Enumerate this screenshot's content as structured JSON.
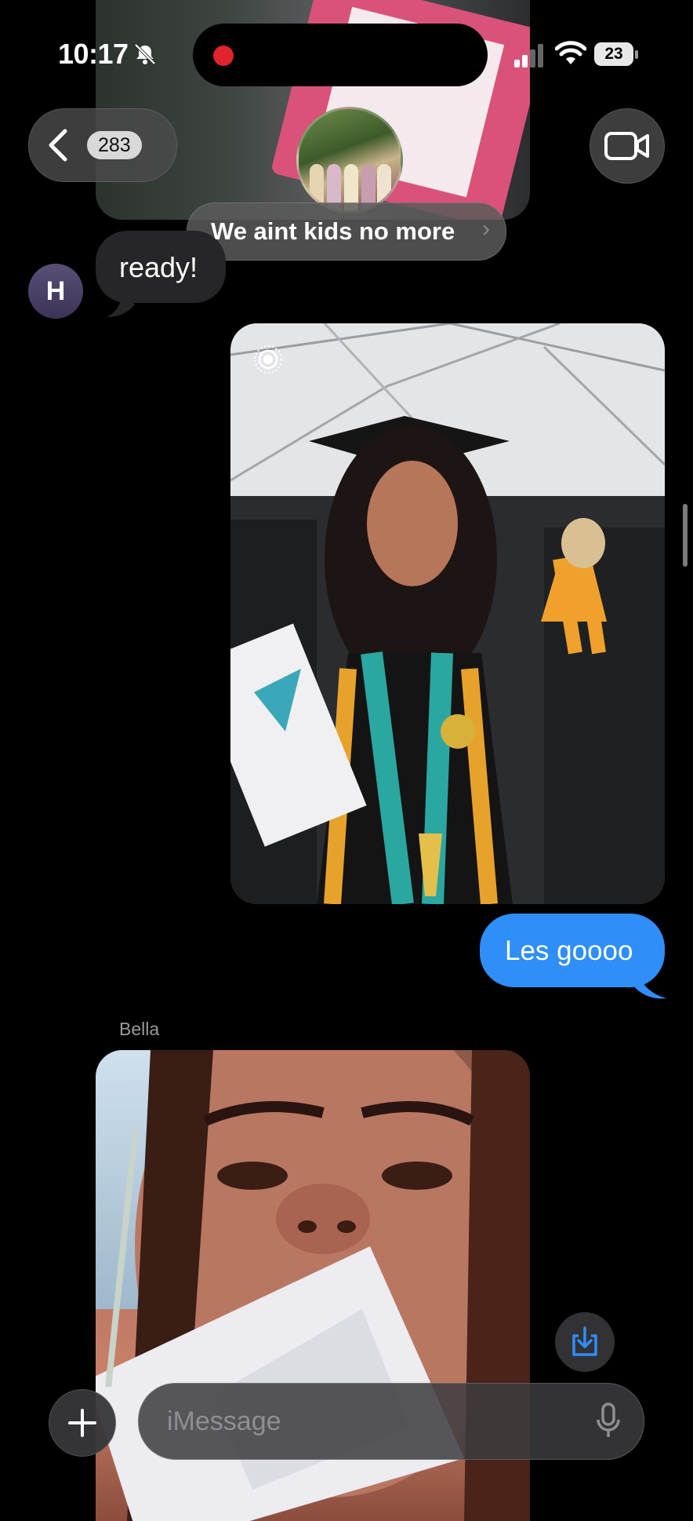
{
  "status_bar": {
    "time": "10:17",
    "battery": "23"
  },
  "header": {
    "back_count": "283",
    "group_name": "We aint kids no more",
    "chevron": "›"
  },
  "messages": [
    {
      "id": "ready",
      "type": "text",
      "direction": "incoming",
      "avatar_letter": "H",
      "text": "ready!"
    },
    {
      "id": "grad-photo",
      "type": "photo",
      "direction": "outgoing",
      "icon": "live-photo-icon"
    },
    {
      "id": "les-goooo",
      "type": "text",
      "direction": "outgoing",
      "text": "Les goooo"
    },
    {
      "id": "bella-photo",
      "type": "photo",
      "direction": "incoming",
      "sender": "Bella"
    }
  ],
  "compose": {
    "placeholder": "iMessage"
  },
  "colors": {
    "outgoing_bubble": "#2f8ef7",
    "incoming_bubble": "#262628",
    "background": "#000000",
    "recording_dot": "#e0242b"
  }
}
